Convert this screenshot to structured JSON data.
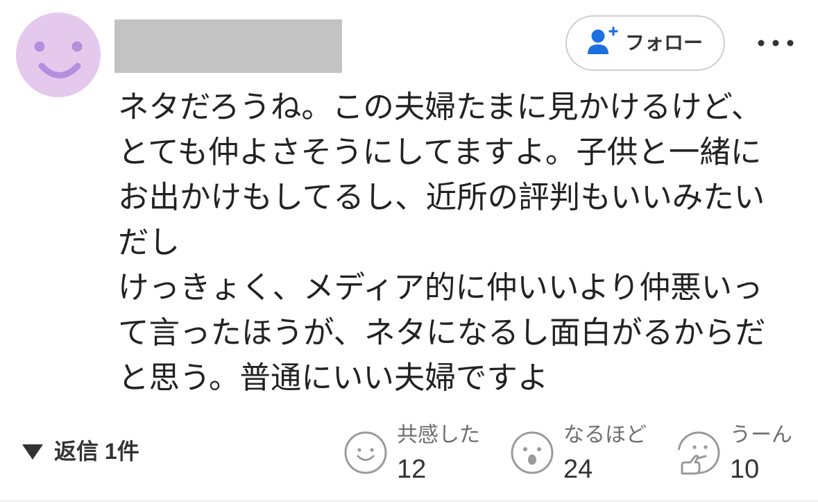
{
  "comment": {
    "avatar_icon": "smiley-face",
    "follow_button": {
      "label": "フォロー",
      "icon": "add-user"
    },
    "more_icon": "more-horizontal",
    "lines": [
      "ネタだろうね。この夫婦たまに見かけるけど、",
      "とても仲よさそうにしてますよ。子供と一緒に",
      "お出かけもしてるし、近所の評判もいいみたい",
      "だし",
      "けっきょく、メディア的に仲いいより仲悪いっ",
      "て言ったほうが、ネタになるし面白がるからだ",
      "と思う。普通にいい夫婦ですよ"
    ]
  },
  "footer": {
    "replies": {
      "label": "返信 1件",
      "icon": "triangle-down"
    },
    "reactions": [
      {
        "label": "共感した",
        "count": 12,
        "icon": "smile"
      },
      {
        "label": "なるほど",
        "count": 24,
        "icon": "surprised-face"
      },
      {
        "label": "うーん",
        "count": 10,
        "icon": "thinking-face"
      }
    ]
  },
  "colors": {
    "avatar_bg": "#e5c9ec",
    "avatar_face": "#b58fdd",
    "follow_icon": "#1d6fe0",
    "text": "#222222",
    "icon_gray": "#9a9a9a"
  }
}
